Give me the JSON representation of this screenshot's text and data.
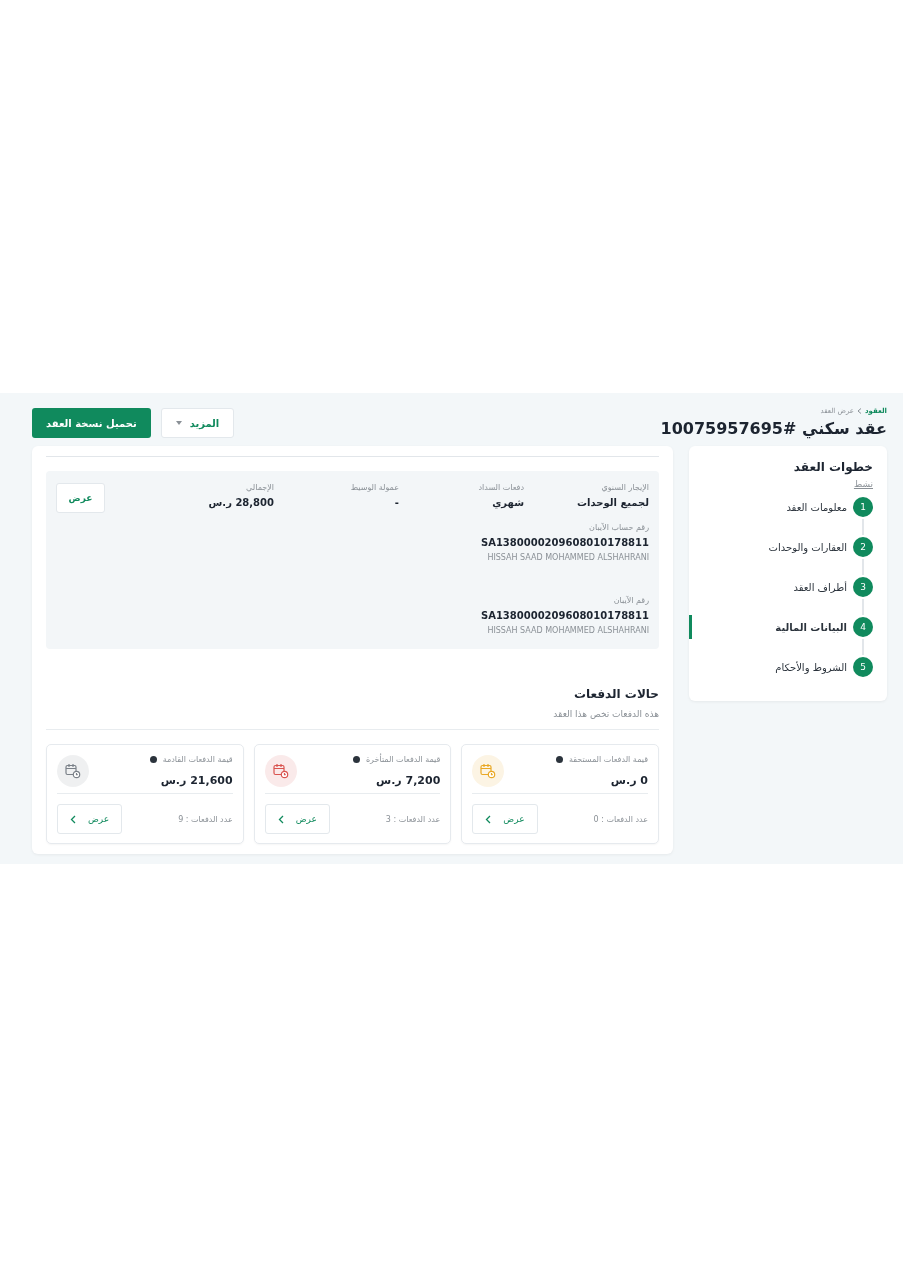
{
  "breadcrumb": [
    {
      "label": "العقود",
      "link": true
    },
    {
      "label": "عرض العقد",
      "link": false
    }
  ],
  "title": "عقد سكني #10075957695",
  "actions": {
    "more": "المزيد",
    "download": "تحميل نسخة العقد"
  },
  "steps_panel": {
    "title": "خطوات العقد",
    "status": "نشط",
    "steps": [
      {
        "number": "1",
        "label": "معلومات العقد",
        "selected": false
      },
      {
        "number": "2",
        "label": "العقارات والوحدات",
        "selected": false
      },
      {
        "number": "3",
        "label": "أطراف العقد",
        "selected": false
      },
      {
        "number": "4",
        "label": "البيانات المالية",
        "selected": true
      },
      {
        "number": "5",
        "label": "الشروط والأحكام",
        "selected": false
      }
    ]
  },
  "financial": {
    "fields": [
      {
        "label": "الإيجار السنوي",
        "value": "لجميع الوحدات"
      },
      {
        "label": "دفعات السداد",
        "value": "شهري"
      },
      {
        "label": "عمولة الوسيط",
        "value": "-"
      },
      {
        "label": "الإجمالي",
        "value": "28,800 ر.س"
      }
    ],
    "view_button": "عرض",
    "accounts": [
      {
        "label": "رقم حساب الآيبان",
        "iban": "SA1380000209608010178811",
        "holder": "HISSAH SAAD MOHAMMED ALSHAHRANI"
      },
      {
        "label": "رقم الآيبان",
        "iban": "SA1380000209608010178811",
        "holder": "HISSAH SAAD MOHAMMED ALSHAHRANI"
      }
    ]
  },
  "payment_status": {
    "title": "حالات الدفعات",
    "subtitle": "هذه الدفعات تخص هذا العقد",
    "cards": [
      {
        "label": "قيمة الدفعات المستحقة",
        "amount": "0 ر.س",
        "count": "عدد الدفعات : 0",
        "button": "عرض",
        "color": "#e9a825"
      },
      {
        "label": "قيمة الدفعات المتأخرة",
        "amount": "7,200 ر.س",
        "count": "عدد الدفعات : 3",
        "button": "عرض",
        "color": "#d9534f"
      },
      {
        "label": "قيمة الدفعات القادمة",
        "amount": "21,600 ر.س",
        "count": "عدد الدفعات : 9",
        "button": "عرض",
        "color": "#7a8088"
      }
    ]
  }
}
